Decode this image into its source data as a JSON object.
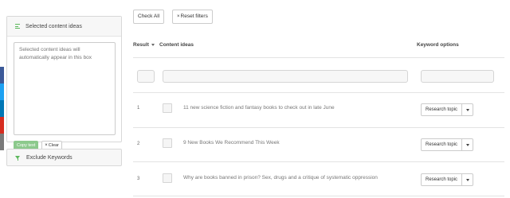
{
  "colors": {
    "accent": "#5cb85c",
    "copy_button": "#8cc98c",
    "social_strip": [
      "#3b5998",
      "#1da1f2",
      "#0077b5",
      "#d62d20",
      "#7a7a7a"
    ]
  },
  "left_panel": {
    "selected_icon": "list-lines-icon",
    "selected_title": "Selected content ideas",
    "textarea_placeholder": "Selected content ideas will automatically appear in this box",
    "copy_label": "Copy text",
    "clear_icon": "×",
    "clear_label": "Clear",
    "exclude_icon": "funnel-icon",
    "exclude_title": "Exclude Keywords"
  },
  "toolbar": {
    "check_all_label": "Check All",
    "reset_icon": "×",
    "reset_label": "Reset filters"
  },
  "table": {
    "headers": {
      "result": "Result",
      "content": "Content ideas",
      "keyword": "Keyword options"
    },
    "rows": [
      {
        "num": "1",
        "idea": "11 new science fiction and fantasy books to check out in late June",
        "action": "Research topic"
      },
      {
        "num": "2",
        "idea": "9 New Books We Recommend This Week",
        "action": "Research topic"
      },
      {
        "num": "3",
        "idea": "Why are books banned in prison? Sex, drugs and a critique of systematic oppression",
        "action": "Research topic"
      }
    ]
  }
}
